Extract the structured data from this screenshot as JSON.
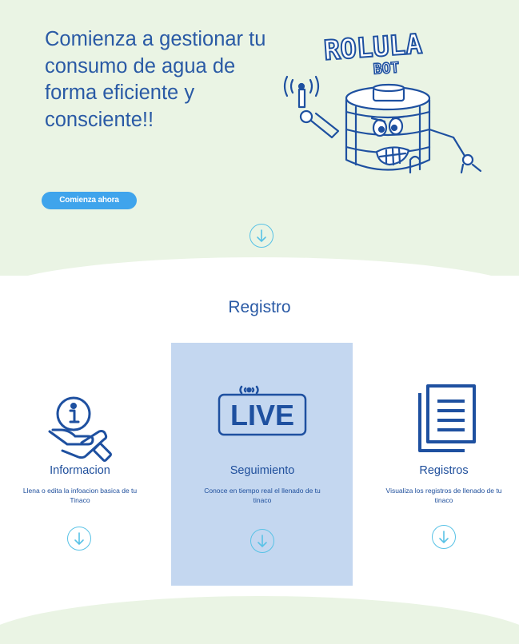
{
  "hero": {
    "title": "Comienza a gestionar tu consumo de agua de forma eficiente y consciente!!",
    "cta_label": "Comienza ahora",
    "logo_text": "ROLULA",
    "logo_subtext": "BOT"
  },
  "section": {
    "title": "Registro"
  },
  "cards": [
    {
      "title": "Informacion",
      "description": "Llena o edita la infoacion basica de tu Tinaco",
      "icon": "info-hand-icon"
    },
    {
      "title": "Seguimiento",
      "description": "Conoce en tiempo real el llenado de tu tinaco",
      "icon": "live-icon",
      "live_text": "LIVE"
    },
    {
      "title": "Registros",
      "description": "Visualiza los registros de llenado de tu tinaco",
      "icon": "document-icon"
    }
  ],
  "colors": {
    "hero_bg": "#eaf4e4",
    "accent": "#3fa4ec",
    "primary": "#2a5aa5",
    "highlight": "#c4d7f0",
    "arrow": "#58c2e6"
  }
}
